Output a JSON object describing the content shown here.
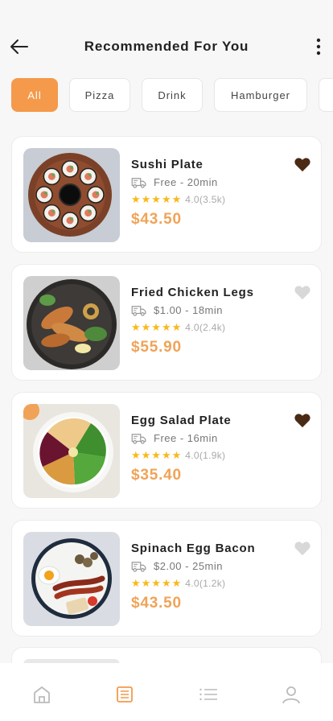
{
  "header": {
    "title": "Recommended For You"
  },
  "filters": [
    {
      "label": "All",
      "active": true,
      "width": 58
    },
    {
      "label": "Pizza",
      "active": false,
      "width": 76
    },
    {
      "label": "Drink",
      "active": false,
      "width": 76
    },
    {
      "label": "Hamburger",
      "active": false,
      "width": 116
    },
    {
      "label": "",
      "active": false,
      "width": 60
    }
  ],
  "items": [
    {
      "name": "Sushi Plate",
      "delivery": "Free - 20min",
      "rating": "4.0(3.5k)",
      "price": "$43.50",
      "favorite": true,
      "image": "sushi"
    },
    {
      "name": "Fried Chicken Legs",
      "delivery": "$1.00 - 18min",
      "rating": "4.0(2.4k)",
      "price": "$55.90",
      "favorite": false,
      "image": "chicken"
    },
    {
      "name": "Egg Salad Plate",
      "delivery": "Free - 16min",
      "rating": "4.0(1.9k)",
      "price": "$35.40",
      "favorite": true,
      "image": "salad"
    },
    {
      "name": "Spinach Egg Bacon",
      "delivery": "$2.00 - 25min",
      "rating": "4.0(1.2k)",
      "price": "$43.50",
      "favorite": false,
      "image": "bacon"
    }
  ],
  "colors": {
    "accent": "#f49a4a",
    "price": "#f0a357",
    "star": "#f8b91a",
    "heart_on": "#4a2a14",
    "heart_off": "#d8d8d8"
  },
  "tabs": [
    {
      "name": "home-icon",
      "active": false
    },
    {
      "name": "orders-icon",
      "active": true
    },
    {
      "name": "list-icon",
      "active": false
    },
    {
      "name": "profile-icon",
      "active": false
    }
  ]
}
